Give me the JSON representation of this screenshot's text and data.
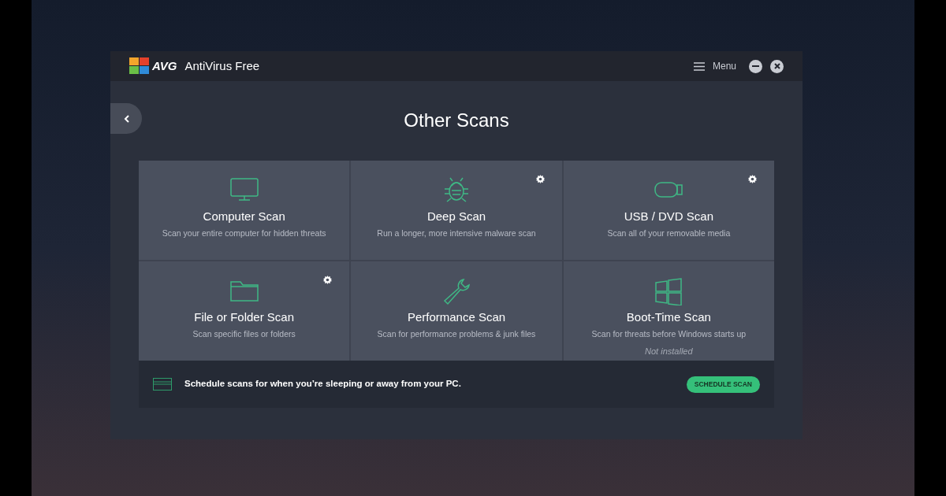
{
  "window": {
    "logo": "AVG",
    "title": "AntiVirus Free",
    "menu": "Menu"
  },
  "page": {
    "title": "Other Scans"
  },
  "tiles": [
    {
      "kind": "monitor",
      "title": "Computer Scan",
      "description": "Scan your entire computer for hidden threats",
      "settings": false
    },
    {
      "kind": "bug",
      "title": "Deep Scan",
      "description": "Run a longer, more intensive malware scan",
      "settings": true
    },
    {
      "kind": "usb",
      "title": "USB / DVD Scan",
      "description": "Scan all of your removable media",
      "settings": true
    },
    {
      "kind": "folder",
      "title": "File or Folder Scan",
      "description": "Scan specific files or folders",
      "settings": true
    },
    {
      "kind": "wrench",
      "title": "Performance Scan",
      "description": "Scan for performance problems & junk files",
      "settings": false
    },
    {
      "kind": "windows",
      "title": "Boot-Time Scan",
      "description": "Scan for threats before Windows starts up",
      "settings": false,
      "note": "Not installed"
    }
  ],
  "schedule": {
    "text": "Schedule scans for when you’re sleeping or away from your PC.",
    "button": "SCHEDULE SCAN"
  }
}
